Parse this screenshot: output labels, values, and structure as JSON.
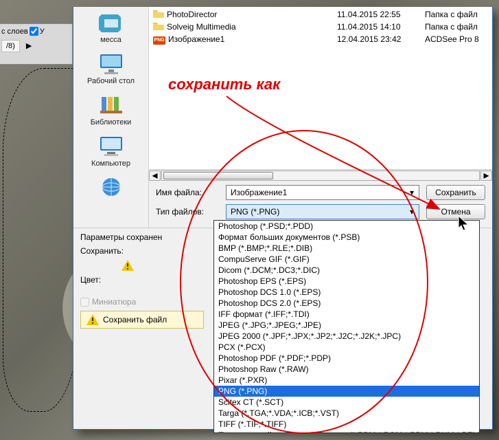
{
  "panel": {
    "layers_label": "с слоев",
    "fraction": "/8)"
  },
  "places": {
    "recent": "месса",
    "desktop": "Рабочий стол",
    "libraries": "Библиотеки",
    "computer": "Компьютер"
  },
  "files": [
    {
      "icon": "folder",
      "name": "PhotoDirector",
      "date": "11.04.2015 22:55",
      "type": "Папка с файл"
    },
    {
      "icon": "folder",
      "name": "Solveig Multimedia",
      "date": "11.04.2015 14:10",
      "type": "Папка с файл"
    },
    {
      "icon": "png",
      "name": "Изображение1",
      "date": "12.04.2015 23:42",
      "type": "ACDSee Pro 8"
    }
  ],
  "labels": {
    "filename": "Имя файла:",
    "filetype": "Тип файлов:",
    "save": "Сохранить",
    "cancel": "Отмена",
    "params_header": "Параметры сохранен",
    "save_as_label": "Сохранить:",
    "color_label": "Цвет:",
    "thumbnail": "Миниатюра",
    "bottom_warn": "Сохранить файл"
  },
  "filename_value": "Изображение1",
  "filetype_value": "PNG (*.PNG)",
  "formats": [
    "Photoshop (*.PSD;*.PDD)",
    "Формат больших документов (*.PSB)",
    "BMP (*.BMP;*.RLE;*.DIB)",
    "CompuServe GIF (*.GIF)",
    "Dicom (*.DCM;*.DC3;*.DIC)",
    "Photoshop EPS (*.EPS)",
    "Photoshop DCS 1.0 (*.EPS)",
    "Photoshop DCS 2.0 (*.EPS)",
    "IFF формат (*.IFF;*.TDI)",
    "JPEG (*.JPG;*.JPEG;*.JPE)",
    "JPEG 2000 (*.JPF;*.JPX;*.JP2;*.J2C;*.J2K;*.JPC)",
    "PCX (*.PCX)",
    "Photoshop PDF (*.PDF;*.PDP)",
    "Photoshop Raw (*.RAW)",
    "Pixar (*.PXR)",
    "PNG (*.PNG)",
    "Scitex CT (*.SCT)",
    "Targa (*.TGA;*.VDA;*.ICB;*.VST)",
    "TIFF (*.TIF;*.TIFF)",
    "Переносимый растровый формат (*.PBM;*.PGM;*.PPM;*.PNM;*.PFM;*.PAM)"
  ],
  "selected_format_index": 15,
  "annotation": "сохранить как"
}
